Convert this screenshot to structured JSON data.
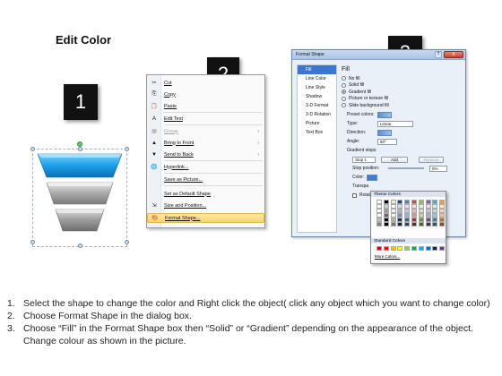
{
  "title": "Edit Color",
  "badges": [
    "1",
    "2",
    "3"
  ],
  "context_menu": {
    "items": [
      {
        "icon": "✂",
        "label": "Cut",
        "arrow": ""
      },
      {
        "icon": "⎘",
        "label": "Copy",
        "arrow": ""
      },
      {
        "icon": "📋",
        "label": "Paste",
        "arrow": ""
      },
      {
        "icon": "A",
        "label": "Edit Text",
        "arrow": ""
      },
      {
        "icon": "▦",
        "label": "Group",
        "arrow": "›"
      },
      {
        "icon": "▲",
        "label": "Bring to Front",
        "arrow": "›"
      },
      {
        "icon": "▼",
        "label": "Send to Back",
        "arrow": "›"
      },
      {
        "icon": "🌐",
        "label": "Hyperlink...",
        "arrow": ""
      },
      {
        "icon": "",
        "label": "Save as Picture...",
        "arrow": ""
      },
      {
        "icon": "",
        "label": "Set as Default Shape",
        "arrow": ""
      },
      {
        "icon": "⇲",
        "label": "Size and Position...",
        "arrow": ""
      },
      {
        "icon": "🎨",
        "label": "Format Shape...",
        "arrow": ""
      }
    ]
  },
  "dialog": {
    "title": "Format Shape",
    "help": "?",
    "close": "X",
    "nav": [
      "Fill",
      "Line Color",
      "Line Style",
      "Shadow",
      "3-D Format",
      "3-D Rotation",
      "Picture",
      "Text Box"
    ],
    "fill_heading": "Fill",
    "fill_options": [
      "No fill",
      "Solid fill",
      "Gradient fill",
      "Picture or texture fill",
      "Slide background fill"
    ],
    "preset_label": "Preset colors:",
    "type_label": "Type:",
    "type_value": "Linear",
    "direction_label": "Direction:",
    "angle_label": "Angle:",
    "angle_value": "90°",
    "gradient_stops_label": "Gradient stops",
    "stop_value": "Stop 1",
    "add_label": "Add",
    "remove_label": "Remove",
    "stop_position_label": "Stop position:",
    "stop_position_value": "0%",
    "color_label": "Color:",
    "transparency_label": "Transpa",
    "rotate_label": "Rotate"
  },
  "color_popup": {
    "theme_heading": "Theme Colors",
    "standard_heading": "Standard Colors",
    "more_colors": "More Colors...",
    "theme_top_row": [
      "#ffffff",
      "#000000",
      "#eeece1",
      "#1f497d",
      "#4f81bd",
      "#c0504d",
      "#9bbb59",
      "#8064a2",
      "#4bacc6",
      "#f79646"
    ],
    "standard_colors": [
      "#c00000",
      "#ff0000",
      "#ffc000",
      "#ffff00",
      "#92d050",
      "#00b050",
      "#00b0f0",
      "#0070c0",
      "#002060",
      "#7030a0"
    ]
  },
  "instructions": [
    {
      "num": "1.",
      "text": "Select the shape to change the color and Right click the object( click any object which you want to change color)"
    },
    {
      "num": "2.",
      "text": "Choose Format Shape in the dialog box."
    },
    {
      "num": "3.",
      "text": "Choose “Fill” in the Format Shape box then “Solid” or “Gradient” depending on the appearance of the object. Change colour as shown in the picture."
    }
  ]
}
